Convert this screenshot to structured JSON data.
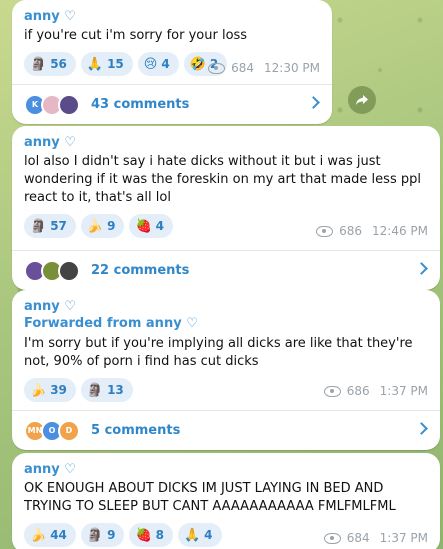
{
  "messages": [
    {
      "author": "anny ♡",
      "forwarded": "",
      "text": "if you're cut i'm sorry for your loss",
      "reactions": [
        {
          "emoji": "🗿",
          "count": "56"
        },
        {
          "emoji": "🙏",
          "count": "15"
        },
        {
          "emoji": "😢",
          "count": "4"
        },
        {
          "emoji": "🤣",
          "count": "2"
        }
      ],
      "views": "684",
      "time": "12:30 PM",
      "comments": "43 comments",
      "avatars": [
        "K",
        "",
        ""
      ]
    },
    {
      "author": "anny ♡",
      "forwarded": "",
      "text": "lol also I didn't say i hate dicks without it but i was just wondering if it was the foreskin on my art that made less ppl react to it, that's all lol",
      "reactions": [
        {
          "emoji": "🗿",
          "count": "57"
        },
        {
          "emoji": "🍌",
          "count": "9"
        },
        {
          "emoji": "🍓",
          "count": "4"
        }
      ],
      "views": "686",
      "time": "12:46 PM",
      "comments": "22 comments",
      "avatars": [
        "",
        "",
        ""
      ]
    },
    {
      "author": "anny ♡",
      "forwarded": "Forwarded from anny ♡",
      "text": "I'm sorry but if you're implying all dicks are like that they're not, 90% of porn i find has cut dicks",
      "reactions": [
        {
          "emoji": "🍌",
          "count": "39"
        },
        {
          "emoji": "🗿",
          "count": "13"
        }
      ],
      "views": "686",
      "time": "1:37 PM",
      "comments": "5 comments",
      "avatars": [
        "MN",
        "O",
        "D"
      ]
    },
    {
      "author": "anny ♡",
      "forwarded": "",
      "text": "OK ENOUGH ABOUT DICKS IM JUST LAYING IN BED AND TRYING TO SLEEP BUT CANT AAAAAAAAAAA FMLFMLFML",
      "reactions": [
        {
          "emoji": "🍌",
          "count": "44"
        },
        {
          "emoji": "🗿",
          "count": "9"
        },
        {
          "emoji": "🍓",
          "count": "8"
        },
        {
          "emoji": "🙏",
          "count": "4"
        }
      ],
      "views": "684",
      "time": "1:37 PM"
    }
  ],
  "icons": {
    "views": "eye-icon",
    "share": "share-icon",
    "chevron": "chevron-right-icon"
  },
  "colors": {
    "accent": "#3a8fd0",
    "reaction_bg": "#e3eef9",
    "bubble": "#ffffff"
  }
}
